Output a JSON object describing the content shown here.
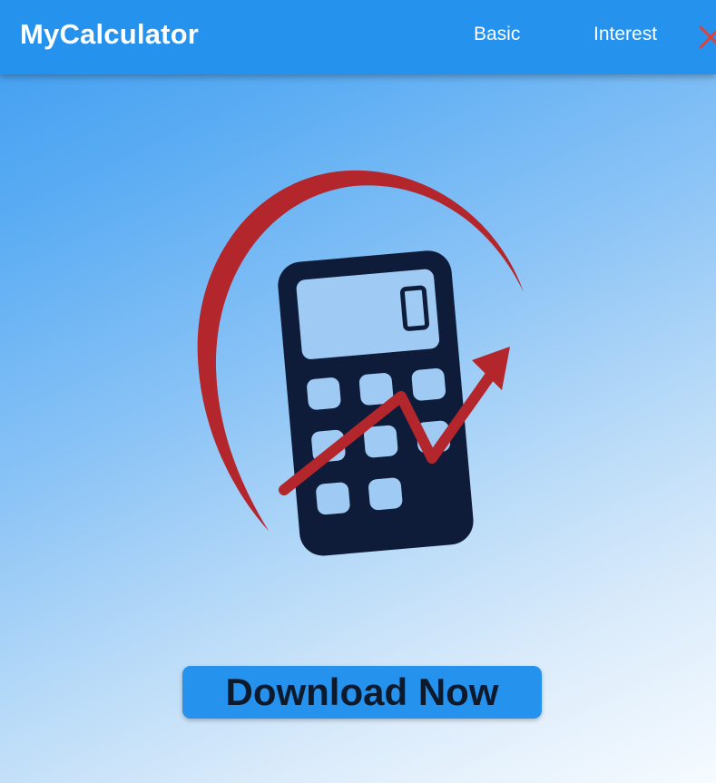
{
  "header": {
    "brand": "MyCalculator",
    "nav": [
      {
        "label": "Basic"
      },
      {
        "label": "Interest"
      }
    ],
    "close_icon": "close-icon"
  },
  "hero": {
    "logo_icon": "calculator-growth-logo-icon",
    "cta_label": "Download Now"
  },
  "colors": {
    "header_bg": "#2592ee",
    "button_bg": "#2592ee",
    "logo_dark": "#0e1c3a",
    "logo_red": "#b3262b",
    "close_red": "#e0423a"
  }
}
